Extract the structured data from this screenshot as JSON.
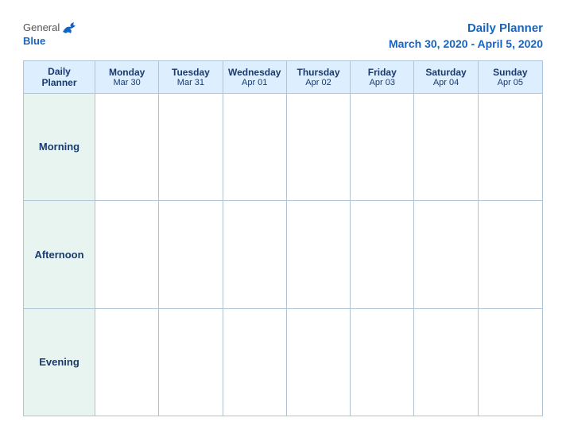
{
  "logo": {
    "general": "General",
    "blue": "Blue"
  },
  "title": {
    "main": "Daily Planner",
    "date_range": "March 30, 2020 - April 5, 2020"
  },
  "header_row": {
    "label_col": {
      "line1": "Daily",
      "line2": "Planner"
    },
    "days": [
      {
        "name": "Monday",
        "date": "Mar 30"
      },
      {
        "name": "Tuesday",
        "date": "Mar 31"
      },
      {
        "name": "Wednesday",
        "date": "Apr 01"
      },
      {
        "name": "Thursday",
        "date": "Apr 02"
      },
      {
        "name": "Friday",
        "date": "Apr 03"
      },
      {
        "name": "Saturday",
        "date": "Apr 04"
      },
      {
        "name": "Sunday",
        "date": "Apr 05"
      }
    ]
  },
  "rows": [
    {
      "label": "Morning"
    },
    {
      "label": "Afternoon"
    },
    {
      "label": "Evening"
    }
  ]
}
